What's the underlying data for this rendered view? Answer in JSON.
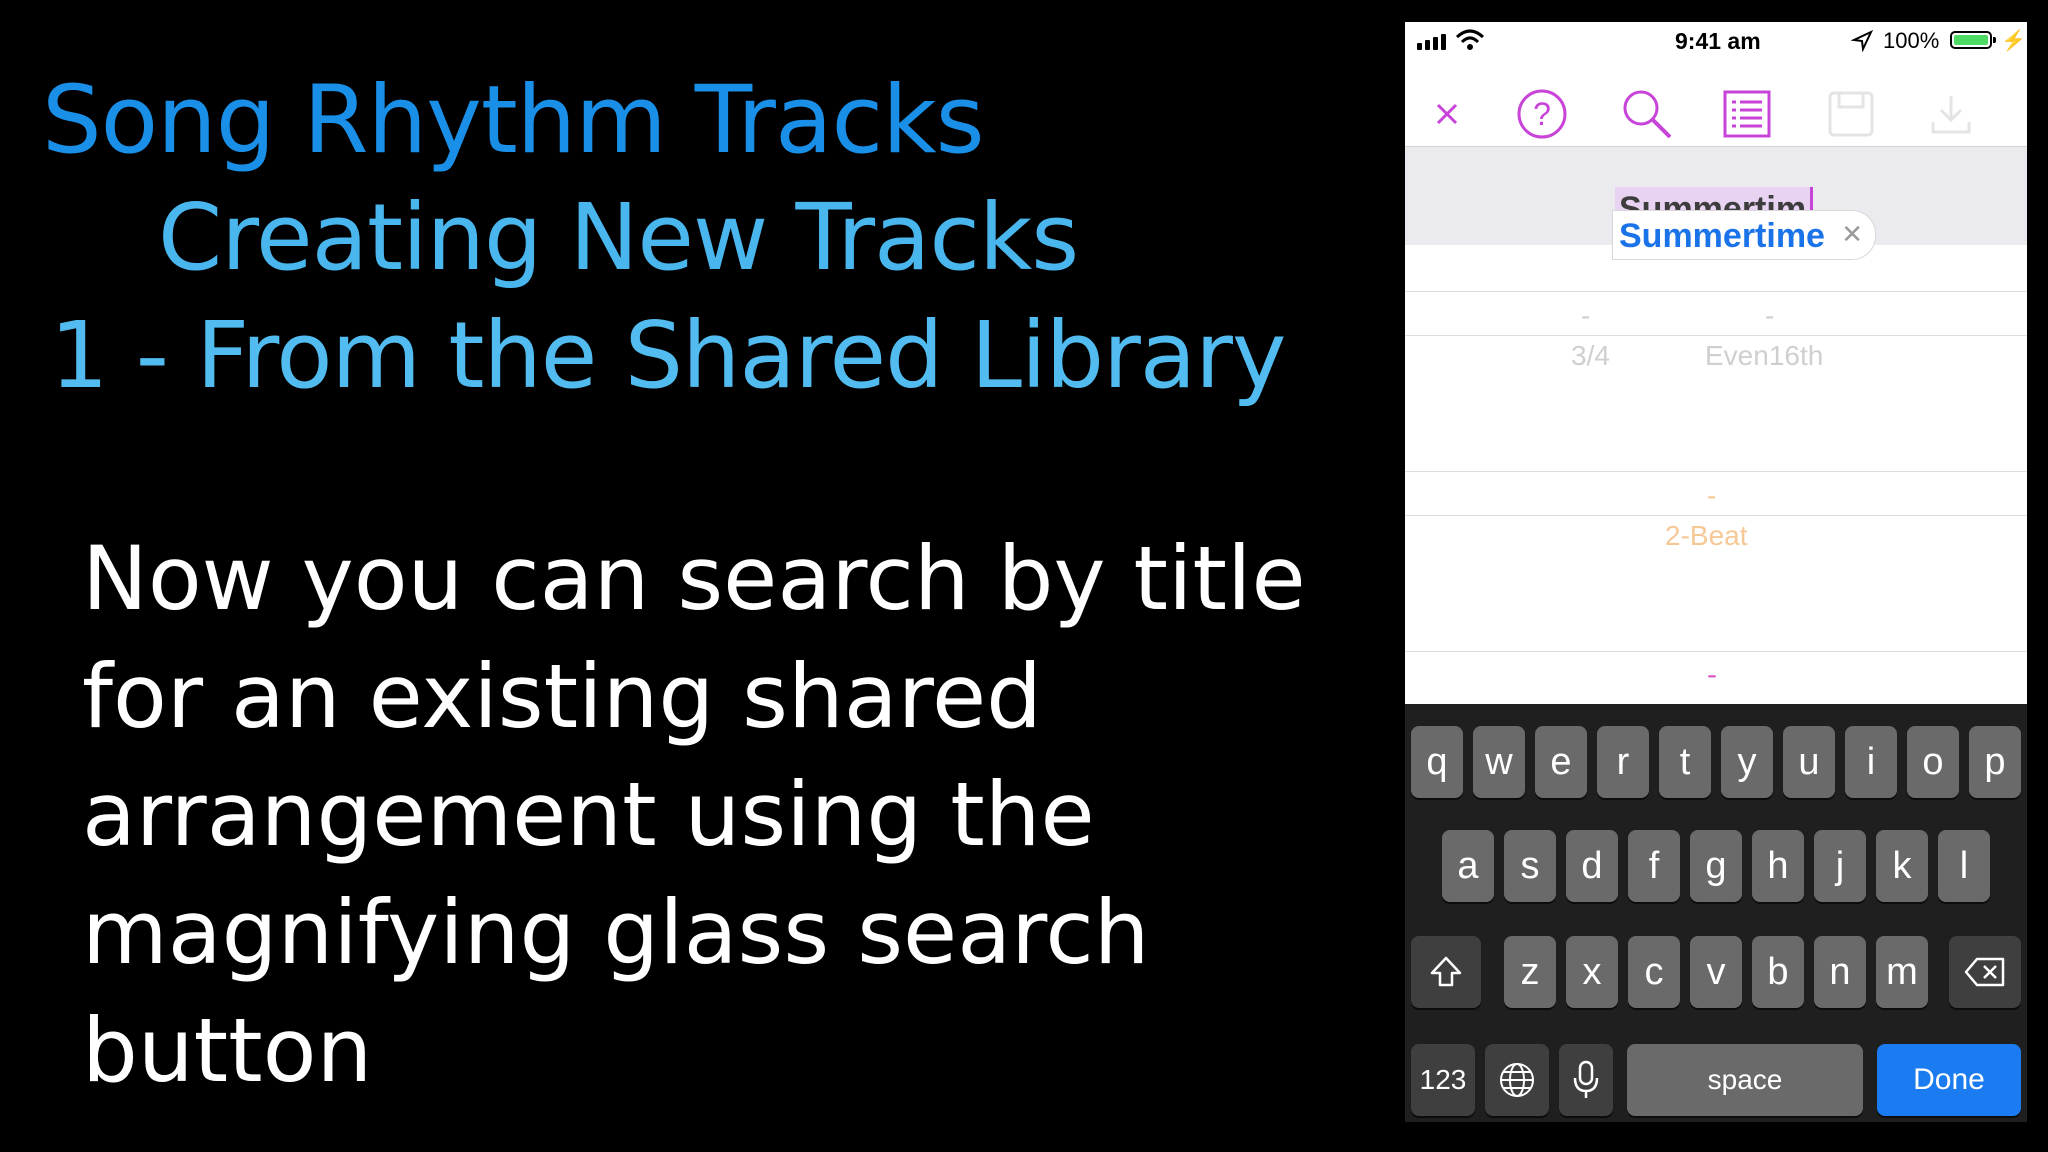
{
  "slide": {
    "title_line1": "Song Rhythm Tracks",
    "title_line2": "Creating New Tracks",
    "title_line3": "1 - From the Shared Library",
    "body_lines": [
      "Now you can search by title",
      "for an existing shared",
      "arrangement using the",
      "magnifying glass search",
      "button"
    ]
  },
  "phone": {
    "status": {
      "time": "9:41 am",
      "battery_pct": "100%",
      "battery_level": 1.0
    },
    "toolbar": {
      "icons": [
        "close-icon",
        "help-icon",
        "search-icon",
        "list-icon",
        "save-icon",
        "download-icon"
      ],
      "accent": "#c844d8"
    },
    "search": {
      "value": "Summertim",
      "suggestion": "Summertime"
    },
    "rows": {
      "row1_dash_a": "-",
      "row1_dash_b": "-",
      "time_sig": "3/4",
      "groove": "Even16th",
      "orange_dash": "-",
      "style": "2-Beat",
      "pink_dash": "-"
    },
    "keyboard": {
      "row1": [
        "q",
        "w",
        "e",
        "r",
        "t",
        "y",
        "u",
        "i",
        "o",
        "p"
      ],
      "row2": [
        "a",
        "s",
        "d",
        "f",
        "g",
        "h",
        "j",
        "k",
        "l"
      ],
      "row3": [
        "z",
        "x",
        "c",
        "v",
        "b",
        "n",
        "m"
      ],
      "numbers_label": "123",
      "space_label": "space",
      "done_label": "Done"
    }
  }
}
